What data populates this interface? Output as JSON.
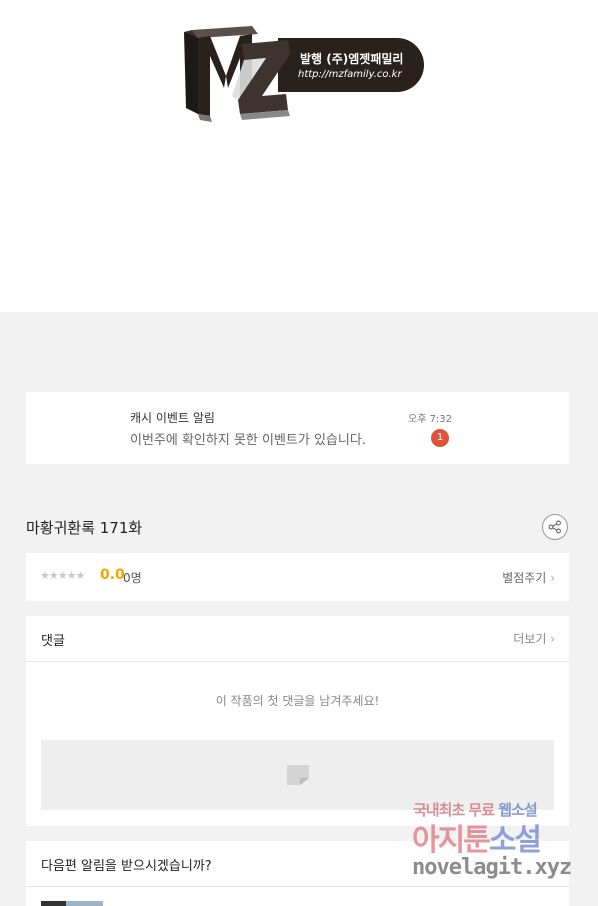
{
  "logo": {
    "letters": "MZ",
    "publisher": "발행 (주)엠젯패밀리",
    "url": "http://mzfamily.co.kr",
    "colors": {
      "dark": "#2a211c",
      "text": "#ffffff"
    }
  },
  "notification": {
    "title": "캐시 이벤트 알림",
    "body": "이번주에 확인하지 못한 이벤트가 있습니다.",
    "time": "오후 7:32",
    "badge_count": "1",
    "badge_color": "#e0533a"
  },
  "episode": {
    "title": "마황귀환록 171화",
    "share_icon": "share-icon"
  },
  "rating": {
    "stars": "★★★★★",
    "score": "0.0",
    "count": "0명",
    "rate_link": "별점주기",
    "chevron": "›",
    "score_color": "#f0a500"
  },
  "comments": {
    "title": "댓글",
    "more_link": "더보기",
    "chevron": "›",
    "empty_message": "이 작품의 첫 댓글을 남겨주세요!",
    "input_icon": "comment-write-icon"
  },
  "next_episode": {
    "prompt": "다음편 알림을 받으시겠습니까?"
  },
  "watermark": {
    "line1_a": "국내최초 무료",
    "line1_b": "웹소설",
    "line2_a": "아지툰",
    "line2_b": "소설",
    "line3": "novelagit.xyz"
  }
}
